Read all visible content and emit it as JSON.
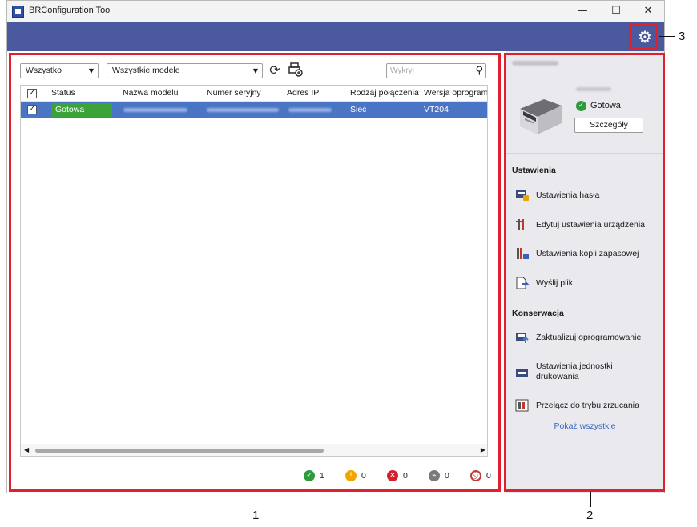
{
  "window": {
    "title": "BRConfiguration Tool",
    "minimize_glyph": "—",
    "maximize_glyph": "☐",
    "close_glyph": "✕"
  },
  "toolbar": {
    "filter_value": "Wszystko",
    "model_filter_value": "Wszystkie modele",
    "refresh_icon": "refresh-icon",
    "add_device_icon": "add-device-icon",
    "search_placeholder": "Wykryj",
    "search_icon": "search-icon"
  },
  "table": {
    "columns": [
      "Status",
      "Nazwa modelu",
      "Numer seryjny",
      "Adres IP",
      "Rodzaj połączenia",
      "Wersja oprogramowania"
    ],
    "rows": [
      {
        "checked": true,
        "status": "Gotowa",
        "connection": "Sieć",
        "firmware": "VT204"
      }
    ]
  },
  "status_bar": {
    "ok": 1,
    "warning": 0,
    "error": 0,
    "offline": 0,
    "disabled": 0
  },
  "device_panel": {
    "status": "Gotowa",
    "details_label": "Szczegóły"
  },
  "settings_section": {
    "title": "Ustawienia",
    "items": [
      {
        "label": "Ustawienia hasła",
        "icon": "password-settings-icon"
      },
      {
        "label": "Edytuj ustawienia urządzenia",
        "icon": "device-settings-icon"
      },
      {
        "label": "Ustawienia kopii zapasowej",
        "icon": "backup-settings-icon"
      },
      {
        "label": "Wyślij plik",
        "icon": "send-file-icon"
      }
    ]
  },
  "maintenance_section": {
    "title": "Konserwacja",
    "items": [
      {
        "label": "Zaktualizuj oprogramowanie",
        "icon": "update-firmware-icon"
      },
      {
        "label": "Ustawienia jednostki drukowania",
        "icon": "print-unit-settings-icon"
      },
      {
        "label": "Przełącz do trybu zrzucania",
        "icon": "dump-mode-icon"
      }
    ],
    "show_all_label": "Pokaż wszystkie"
  },
  "callouts": [
    "1",
    "2",
    "3"
  ],
  "colors": {
    "accent_band": "#4b5a9e",
    "row_selected": "#4a74c4",
    "status_ready": "#3aa33a",
    "callout": "#e0202c",
    "link": "#3b64c2"
  }
}
